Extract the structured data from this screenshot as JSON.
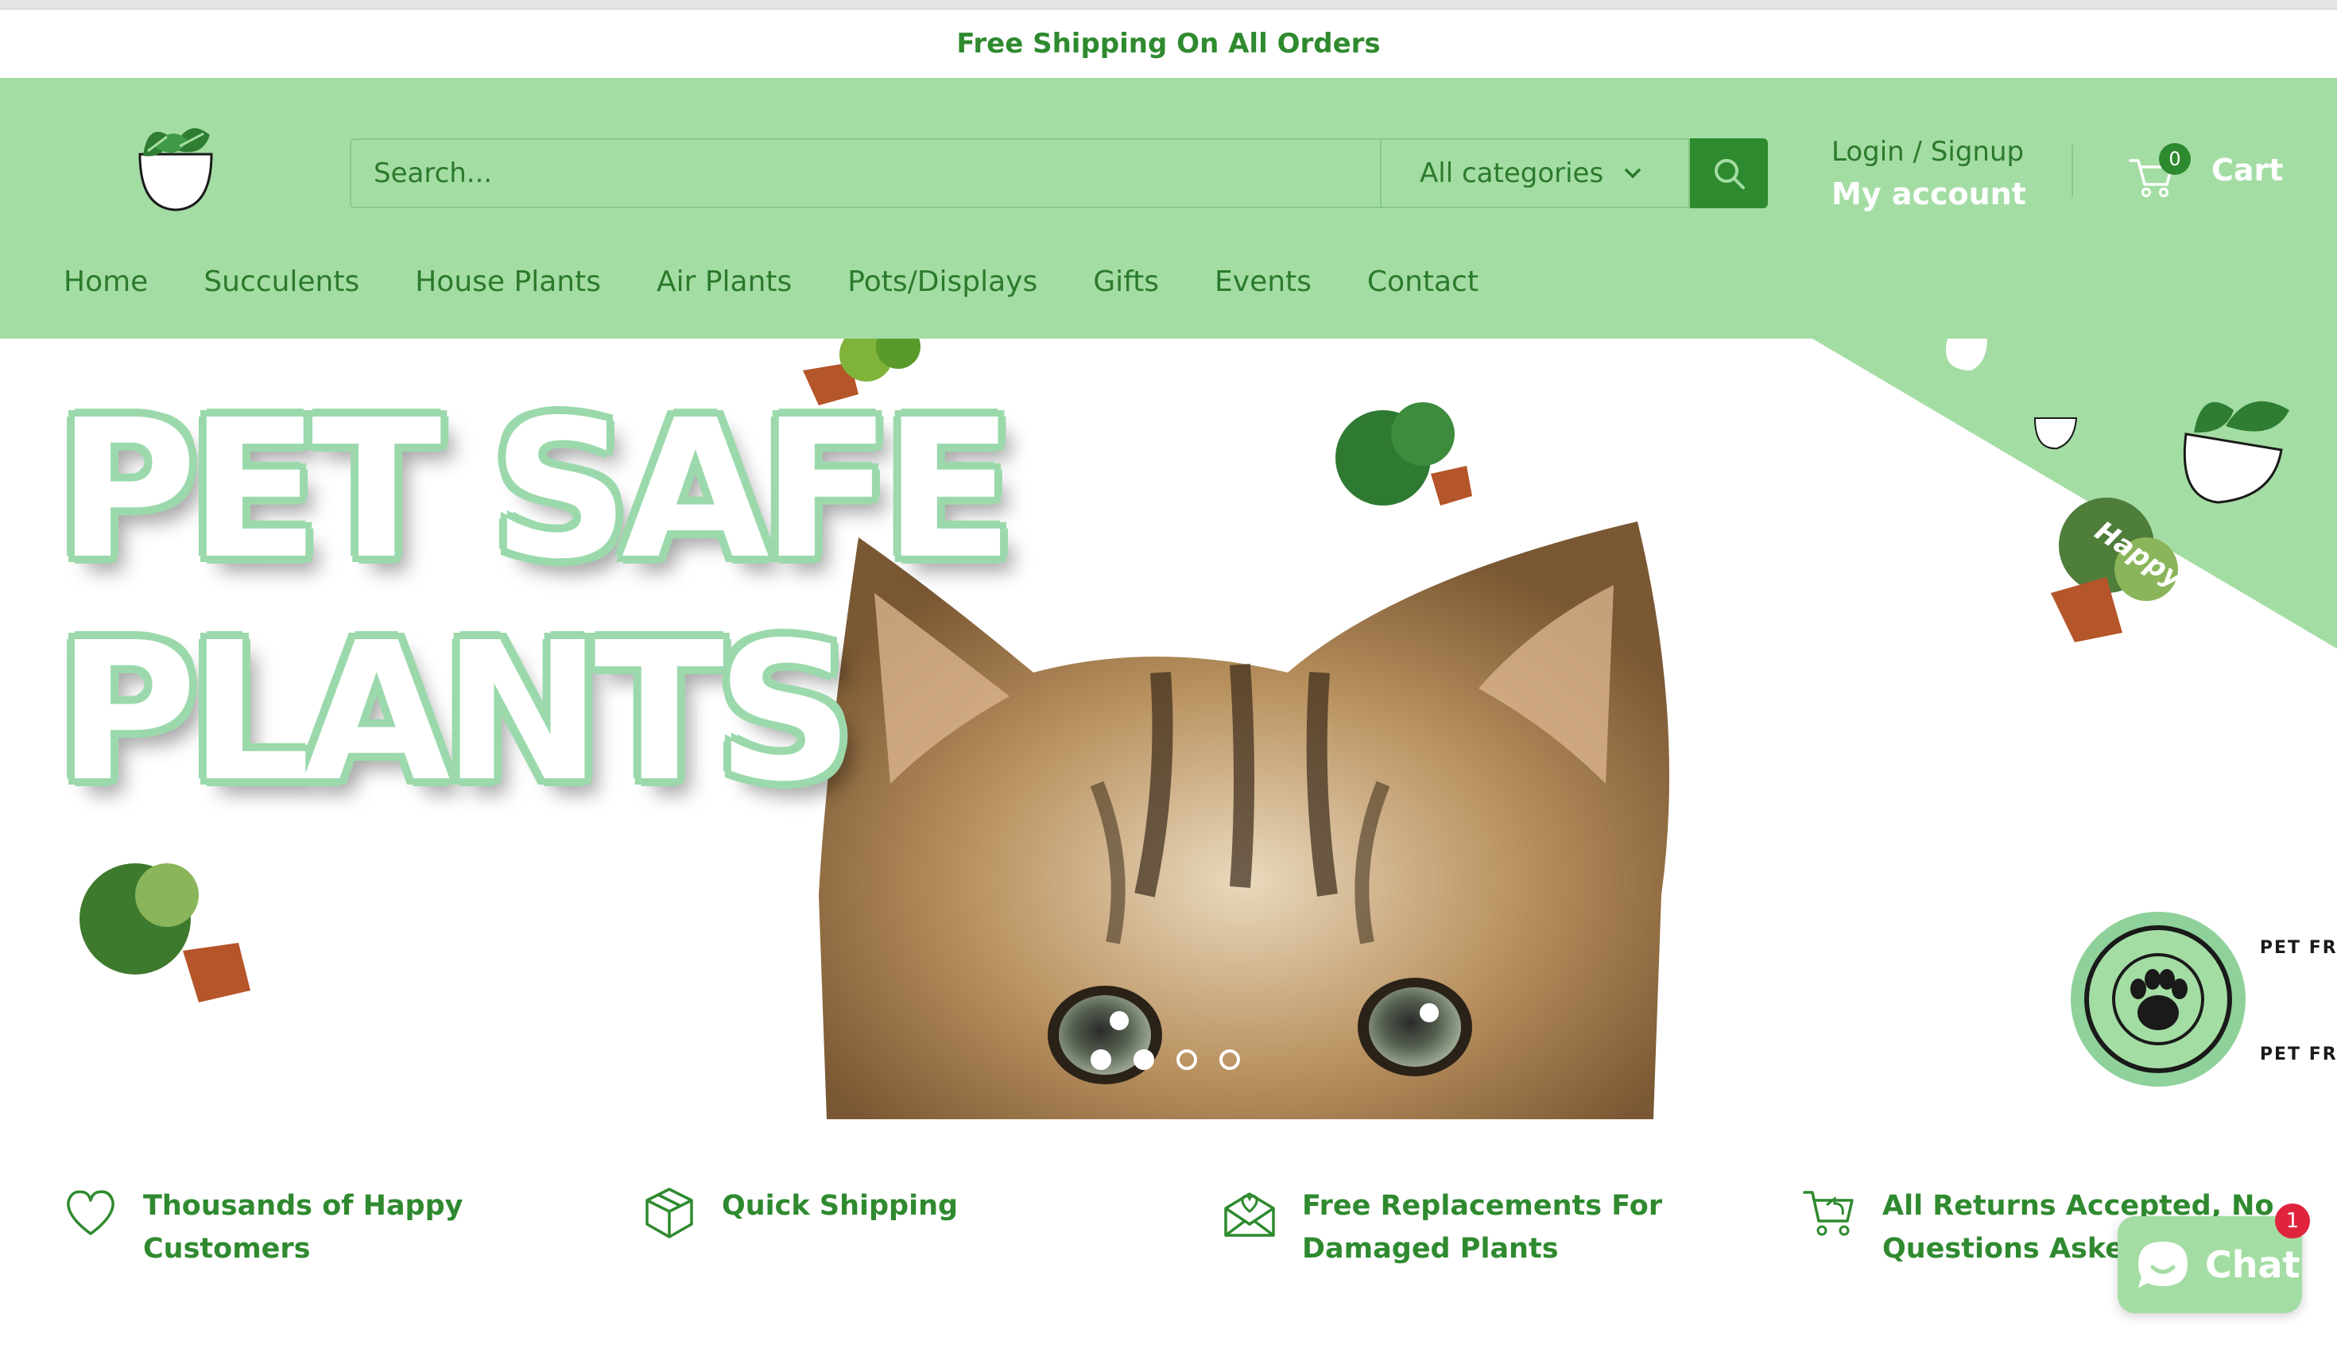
{
  "announcement": {
    "text": "Free Shipping On All Orders"
  },
  "header": {
    "search": {
      "placeholder": "Search...",
      "category": "All categories"
    },
    "account": {
      "login_label": "Login / Signup",
      "my_account_label": "My account"
    },
    "cart": {
      "count": "0",
      "label": "Cart"
    }
  },
  "nav": {
    "items": [
      {
        "label": "Home"
      },
      {
        "label": "Succulents"
      },
      {
        "label": "House Plants"
      },
      {
        "label": "Air Plants"
      },
      {
        "label": "Pots/Displays"
      },
      {
        "label": "Gifts"
      },
      {
        "label": "Events"
      },
      {
        "label": "Contact"
      }
    ]
  },
  "hero": {
    "title_line1": "PET SAFE",
    "title_line2": "PLANTS",
    "ribbon_text": "Happy Plant",
    "badge_top": "PET FRIENDLY",
    "badge_bottom": "PET FRIENDLY",
    "slide_count": 4,
    "active_slide": 1
  },
  "features": [
    {
      "line1": "Thousands of Happy",
      "line2": "Customers",
      "icon": "heart-icon"
    },
    {
      "line1": "Quick Shipping",
      "line2": "",
      "icon": "box-icon"
    },
    {
      "line1": "Free Replacements For",
      "line2": "Damaged Plants",
      "icon": "envelope-heart-icon"
    },
    {
      "line1": "All Returns Accepted, No",
      "line2": "Questions Asked",
      "icon": "cart-return-icon"
    }
  ],
  "chat": {
    "label": "Chat",
    "unread": "1"
  },
  "colors": {
    "header_bg": "#a4dda4",
    "brand_green": "#2e8a2e",
    "text_green": "#2b7a2b",
    "badge_red": "#e0243e"
  }
}
